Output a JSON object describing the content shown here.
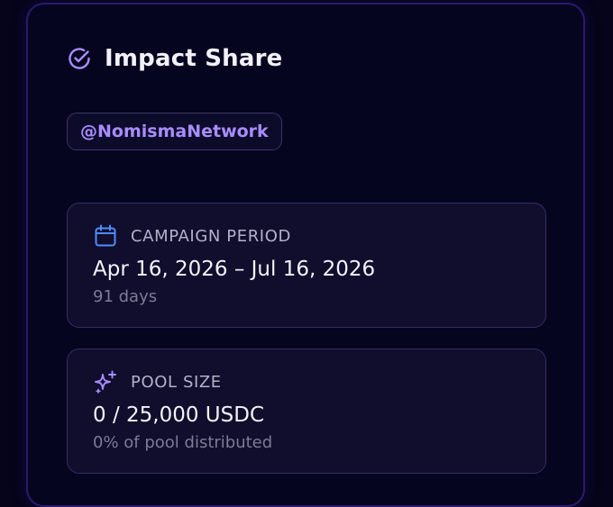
{
  "colors": {
    "background": "#05041a",
    "panel_border": "#2b1a6e",
    "accent_purple": "#a98dff",
    "icon_blue": "#4f8cff",
    "card_border": "#332d66"
  },
  "header": {
    "icon": "check-circle-icon",
    "title": "Impact Share"
  },
  "tag": {
    "label": "@NomismaNetwork"
  },
  "campaign_period": {
    "icon": "calendar-icon",
    "label": "CAMPAIGN PERIOD",
    "value": "Apr 16, 2026 – Jul 16, 2026",
    "sub": "91 days"
  },
  "pool_size": {
    "icon": "sparkles-icon",
    "label": "POOL SIZE",
    "value": "0 / 25,000 USDC",
    "sub": "0% of pool distributed"
  }
}
